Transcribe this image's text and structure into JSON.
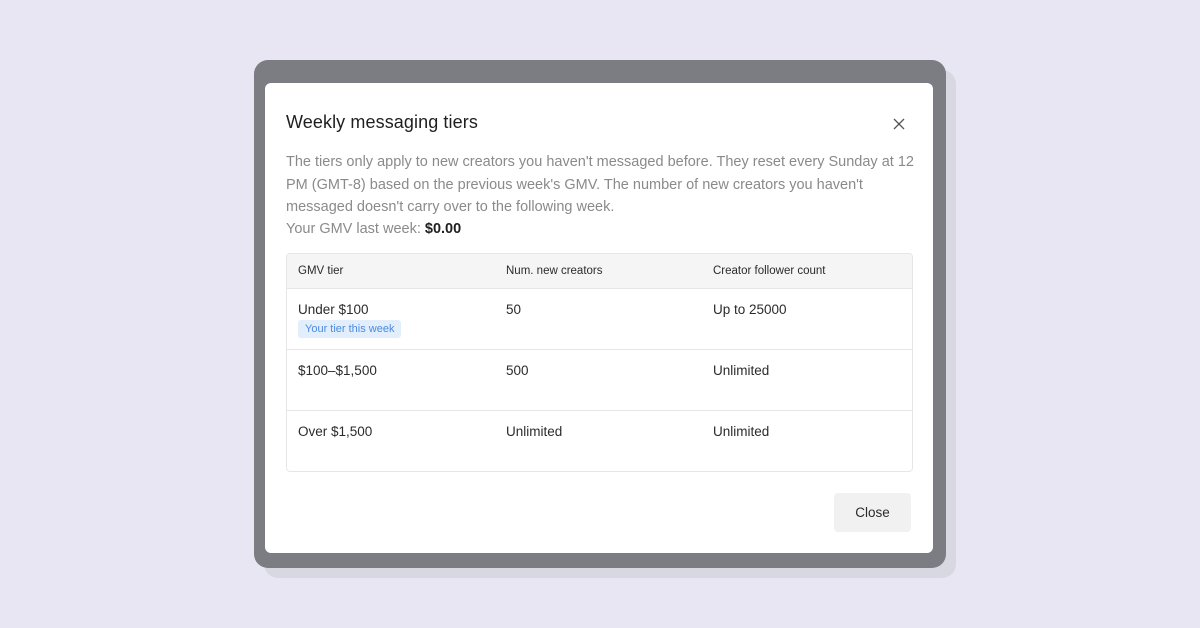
{
  "modal": {
    "title": "Weekly messaging tiers",
    "description": "The tiers only apply to new creators you haven't messaged before. They reset every Sunday at 12 PM (GMT-8) based on the previous week's GMV. The number of new creators you haven't messaged doesn't carry over to the following week.",
    "gmv_label": "Your GMV last week:",
    "gmv_value": "$0.00",
    "close_button_label": "Close",
    "close_icon": "close-icon"
  },
  "table": {
    "headers": [
      "GMV tier",
      "Num. new creators",
      "Creator follower count"
    ],
    "rows": [
      {
        "tier": "Under $100",
        "creators": "50",
        "followers": "Up to 25000",
        "badge": "Your tier this week"
      },
      {
        "tier": "$100–$1,500",
        "creators": "500",
        "followers": "Unlimited"
      },
      {
        "tier": "Over $1,500",
        "creators": "Unlimited",
        "followers": "Unlimited"
      }
    ]
  },
  "colors": {
    "page_background": "#e7e6f2",
    "overlay": "#7c7d83",
    "badge_background": "#e3eefc",
    "badge_text": "#4a8be0"
  }
}
